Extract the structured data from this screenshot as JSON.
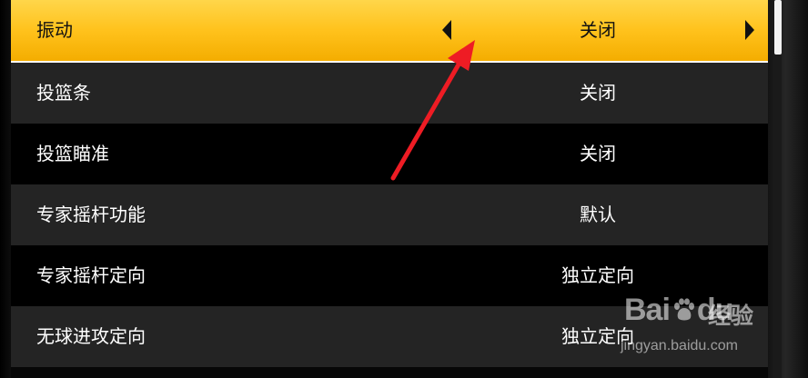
{
  "menu": {
    "rows": [
      {
        "label": "振动",
        "value": "关闭"
      },
      {
        "label": "投篮条",
        "value": "关闭"
      },
      {
        "label": "投篮瞄准",
        "value": "关闭"
      },
      {
        "label": "专家摇杆功能",
        "value": "默认"
      },
      {
        "label": "专家摇杆定向",
        "value": "独立定向"
      },
      {
        "label": "无球进攻定向",
        "value": "独立定向"
      }
    ],
    "selected_index": 0
  },
  "watermark": {
    "brand_left": "Bai",
    "brand_right": "du",
    "brand_cn": "经验",
    "url": "jingyan.baidu.com"
  },
  "colors": {
    "highlight": "#ffc21c",
    "annotation_arrow": "#ee1c24"
  },
  "icons": {
    "left_arrow": "chevron-left-icon",
    "right_arrow": "chevron-right-icon",
    "paw": "baidu-paw-icon"
  }
}
